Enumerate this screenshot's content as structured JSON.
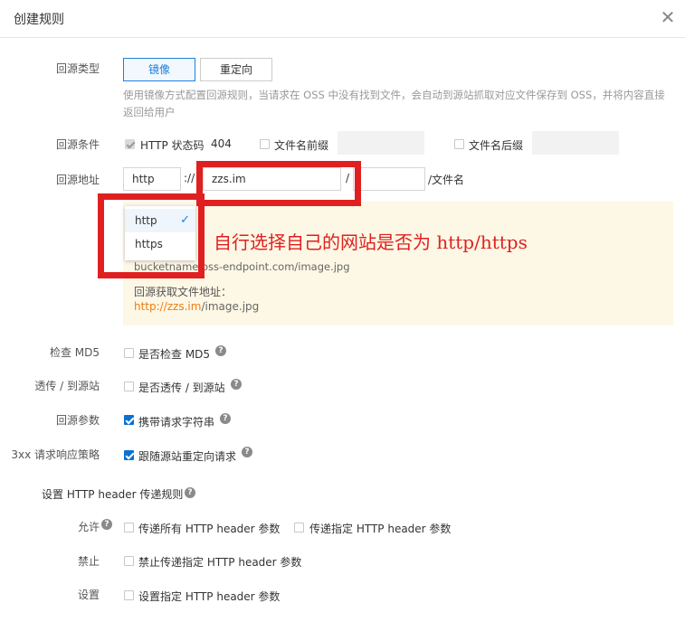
{
  "dialog": {
    "title": "创建规则",
    "close_glyph": "✕"
  },
  "rule_type": {
    "label": "回源类型",
    "options": [
      "镜像",
      "重定向"
    ],
    "selected": "镜像",
    "description": "使用镜像方式配置回源规则，当请求在 OSS 中没有找到文件，会自动到源站抓取对应文件保存到 OSS，并将内容直接返回给用户"
  },
  "condition": {
    "label": "回源条件",
    "status_code_label": "HTTP 状态码",
    "status_code_value": "404",
    "prefix_label": "文件名前缀",
    "suffix_label": "文件名后缀"
  },
  "address": {
    "label": "回源地址",
    "protocol": "http",
    "separator": "://",
    "domain": "zzs.im",
    "slash": "/",
    "filename_suffix": "/文件名"
  },
  "protocol_dropdown": {
    "options": [
      "http",
      "https"
    ],
    "selected": "http",
    "check_glyph": "✓"
  },
  "annotation": "自行选择自己的网站是否为 http/https",
  "info": {
    "sample_url_partial": "bucketname.oss-endpoint.com/image.jpg",
    "fetch_label": "回源获取文件地址：",
    "fetch_highlight": "http://zzs.im",
    "fetch_path": "/image.jpg",
    "highlight_color": "#ee7d11"
  },
  "md5": {
    "label": "检查 MD5",
    "option": "是否检查 MD5",
    "checked": false
  },
  "passthrough": {
    "label": "透传 / 到源站",
    "option": "是否透传 / 到源站",
    "checked": false
  },
  "params": {
    "label": "回源参数",
    "option": "携带请求字符串",
    "checked": true
  },
  "redirect": {
    "label": "3xx 请求响应策略",
    "option": "跟随源站重定向请求",
    "checked": true
  },
  "header_rules": {
    "label": "设置 HTTP header 传递规则",
    "allow_label": "允许",
    "allow_all": "传递所有 HTTP header 参数",
    "allow_specific": "传递指定 HTTP header 参数",
    "deny_label": "禁止",
    "deny_option": "禁止传递指定 HTTP header 参数",
    "set_label": "设置",
    "set_option": "设置指定 HTTP header 参数"
  },
  "help_glyph": "?",
  "colors": {
    "accent": "#1f7fd9",
    "annotation_red": "#e02020",
    "info_bg": "#fdf7e5"
  }
}
